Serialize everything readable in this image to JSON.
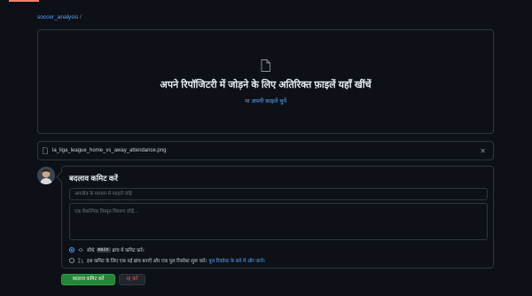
{
  "breadcrumb": {
    "repo": "soccer_analysis",
    "separator": "/"
  },
  "dropzone": {
    "title": "अपने रिपॉजिटरी में जोड़ने के लिए अतिरिक्त फ़ाइलें यहाँ खींचें",
    "sub_prefix": "या",
    "choose_link": "अपनी फ़ाइलें चुनें"
  },
  "file": {
    "name": "la_liga_league_home_vs_away_attendance.png",
    "remove_icon": "close-icon"
  },
  "commit": {
    "title": "बदलाव कमिट करें",
    "summary_placeholder": "अपलोड के माध्यम से फ़ाइलें जोड़ें",
    "description_placeholder": "एक वैकल्पिक विस्तृत विवरण जोड़ें...",
    "option_direct_prefix": "सीधे",
    "option_direct_branch": "main",
    "option_direct_suffix": "ब्रांच में कमिट करें।",
    "option_pr_text": "इस कमिट के लिए एक नई ब्रांच बनाएँ और एक पुल रिक्वेस्ट शुरू करें।",
    "option_pr_link": "पुल रिक्वेस्ट के बारे में और जानें।",
    "selected_option": "direct"
  },
  "buttons": {
    "commit": "बदलाव कमिट करें",
    "cancel": "रद्द करें"
  },
  "colors": {
    "accent": "#58a6ff",
    "primary_button": "#238636",
    "danger": "#f85149",
    "background": "#0d1117"
  }
}
